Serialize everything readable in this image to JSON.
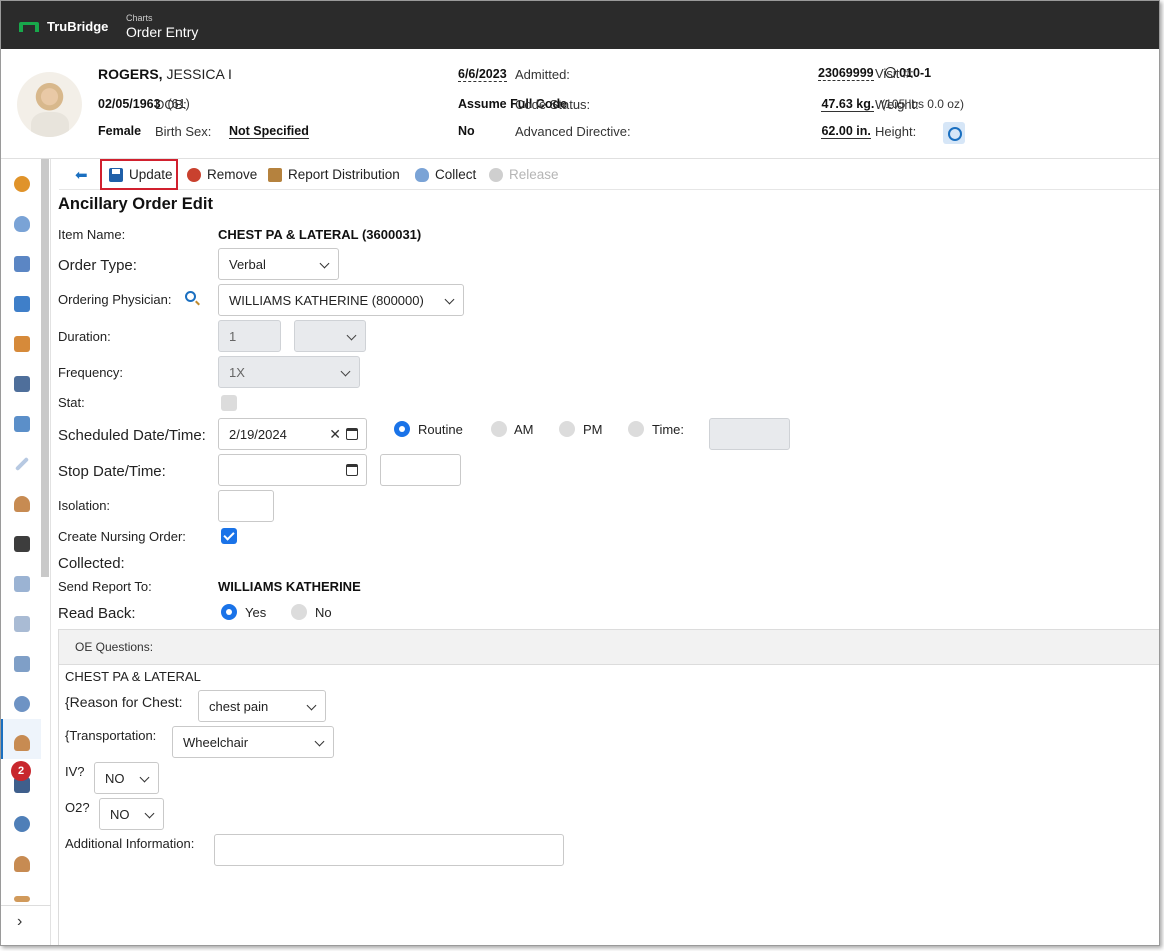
{
  "header": {
    "brand": "TruBridge",
    "breadcrumb_parent": "Charts",
    "page_title": "Order Entry"
  },
  "patient": {
    "last_name": "ROGERS,",
    "first_name": "JESSICA I",
    "dob_label": "DOB:",
    "dob": "02/05/1963",
    "age": "(61)",
    "birth_sex_label": "Birth Sex:",
    "birth_sex": "Female",
    "gender_identity": "Not Specified",
    "admitted_label": "Admitted:",
    "admitted": "6/6/2023",
    "code_status_label": "Code Status:",
    "code_status": "Assume Full Code",
    "advanced_directive_label": "Advanced Directive:",
    "advanced_directive": "No",
    "visit_label": "Visit #:",
    "visit": "23069999",
    "location": "010-1",
    "weight_label": "Weight:",
    "weight": "47.63 kg.",
    "weight_imperial": "(105 lbs 0.0 oz)",
    "height_label": "Height:",
    "height": "62.00 in."
  },
  "rail": {
    "badge_count": "2",
    "expand_icon": "›"
  },
  "toolbar": {
    "back_icon": "⬅",
    "update": "Update",
    "remove": "Remove",
    "report_distribution": "Report Distribution",
    "collect": "Collect",
    "release": "Release"
  },
  "form": {
    "title": "Ancillary Order Edit",
    "item_name_label": "Item Name:",
    "item_name": "CHEST PA & LATERAL (3600031)",
    "order_type_label": "Order Type:",
    "order_type": "Verbal",
    "ordering_physician_label": "Ordering Physician:",
    "ordering_physician": "WILLIAMS KATHERINE (800000)",
    "duration_label": "Duration:",
    "duration_value": "1",
    "duration_unit": "",
    "frequency_label": "Frequency:",
    "frequency": "1X",
    "stat_label": "Stat:",
    "scheduled_label": "Scheduled Date/Time:",
    "scheduled_date": "2/19/2024",
    "clear_icon": "✕",
    "radio_routine": "Routine",
    "radio_am": "AM",
    "radio_pm": "PM",
    "radio_time": "Time:",
    "stop_label": "Stop Date/Time:",
    "isolation_label": "Isolation:",
    "nursing_order_label": "Create Nursing Order:",
    "collected_label": "Collected:",
    "send_report_label": "Send Report To:",
    "send_report_to": "WILLIAMS KATHERINE",
    "read_back_label": "Read Back:",
    "read_back_yes": "Yes",
    "read_back_no": "No"
  },
  "oe_questions": {
    "title": "OE Questions:",
    "item": "CHEST PA & LATERAL",
    "reason_label": "{Reason for Chest:",
    "reason_value": "chest pain",
    "transport_label": "{Transportation:",
    "transport_value": "Wheelchair",
    "iv_label": "IV?",
    "iv_value": "NO",
    "o2_label": "O2?",
    "o2_value": "NO",
    "additional_label": "Additional Information:",
    "additional_value": ""
  },
  "colors": {
    "topbar": "#2b2b2b",
    "brand_green": "#18a84b",
    "accent_blue": "#1a73e8",
    "highlight_red": "#d1202e"
  }
}
